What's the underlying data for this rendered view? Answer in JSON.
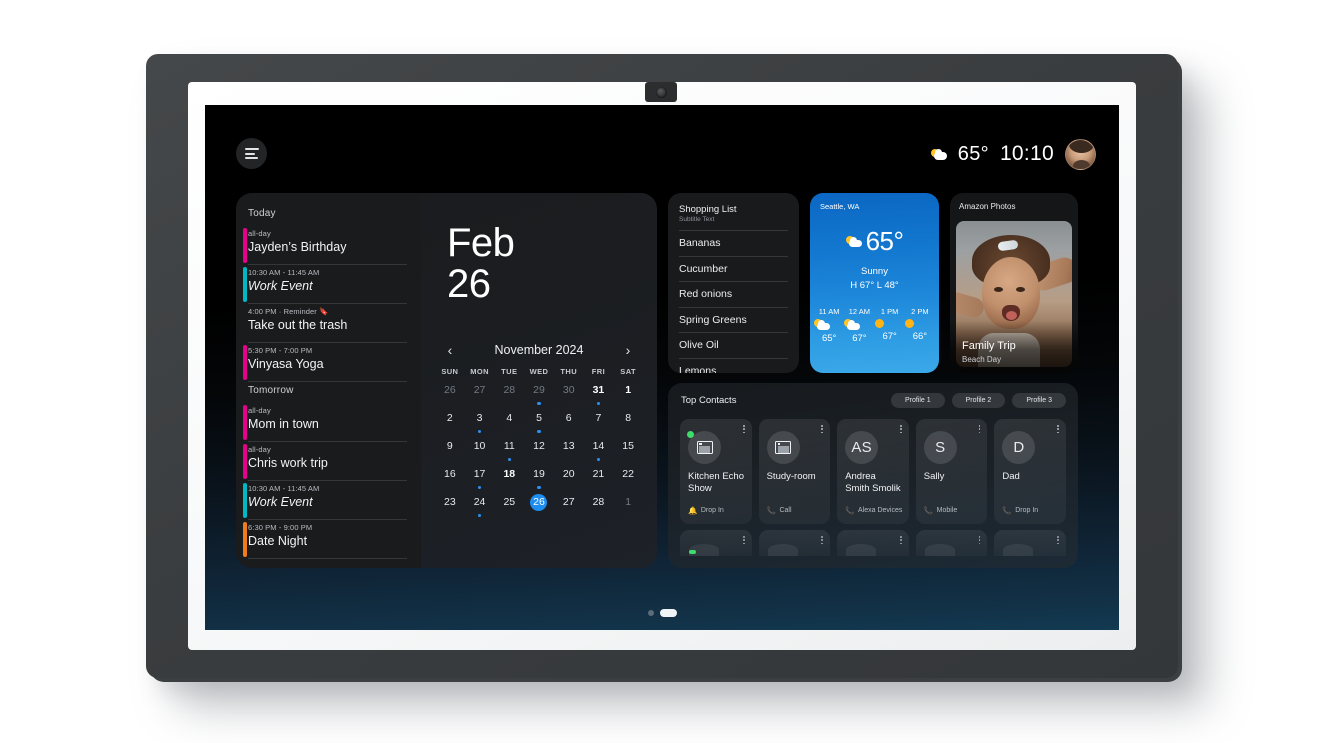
{
  "status_bar": {
    "menu_icon": "hamburger-menu-icon",
    "weather_icon": "partly-cloudy-icon",
    "temperature": "65°",
    "time": "10:10",
    "avatar": "user-avatar"
  },
  "calendar_widget": {
    "big_date": {
      "month": "Feb",
      "day": "26"
    },
    "month_nav": {
      "prev": "‹",
      "label": "November 2024",
      "next": "›"
    },
    "weekdays": [
      "SUN",
      "MON",
      "TUE",
      "WED",
      "THU",
      "FRI",
      "SAT"
    ],
    "weeks": [
      [
        {
          "n": "26",
          "dim": true,
          "bold": false,
          "sel": false,
          "dot": false
        },
        {
          "n": "27",
          "dim": true,
          "bold": false,
          "sel": false,
          "dot": false
        },
        {
          "n": "28",
          "dim": true,
          "bold": false,
          "sel": false,
          "dot": false
        },
        {
          "n": "29",
          "dim": true,
          "bold": false,
          "sel": false,
          "dot": true
        },
        {
          "n": "30",
          "dim": true,
          "bold": false,
          "sel": false,
          "dot": false
        },
        {
          "n": "31",
          "dim": false,
          "bold": true,
          "sel": false,
          "dot": true
        },
        {
          "n": "1",
          "dim": false,
          "bold": true,
          "sel": false,
          "dot": false
        }
      ],
      [
        {
          "n": "2",
          "dim": false,
          "bold": false,
          "sel": false,
          "dot": false
        },
        {
          "n": "3",
          "dim": false,
          "bold": false,
          "sel": false,
          "dot": true
        },
        {
          "n": "4",
          "dim": false,
          "bold": false,
          "sel": false,
          "dot": false
        },
        {
          "n": "5",
          "dim": false,
          "bold": false,
          "sel": false,
          "dot": true
        },
        {
          "n": "6",
          "dim": false,
          "bold": false,
          "sel": false,
          "dot": false
        },
        {
          "n": "7",
          "dim": false,
          "bold": false,
          "sel": false,
          "dot": false
        },
        {
          "n": "8",
          "dim": false,
          "bold": false,
          "sel": false,
          "dot": false
        }
      ],
      [
        {
          "n": "9",
          "dim": false,
          "bold": false,
          "sel": false,
          "dot": false
        },
        {
          "n": "10",
          "dim": false,
          "bold": false,
          "sel": false,
          "dot": false
        },
        {
          "n": "11",
          "dim": false,
          "bold": false,
          "sel": false,
          "dot": true
        },
        {
          "n": "12",
          "dim": false,
          "bold": false,
          "sel": false,
          "dot": false
        },
        {
          "n": "13",
          "dim": false,
          "bold": false,
          "sel": false,
          "dot": false
        },
        {
          "n": "14",
          "dim": false,
          "bold": false,
          "sel": false,
          "dot": true
        },
        {
          "n": "15",
          "dim": false,
          "bold": false,
          "sel": false,
          "dot": false
        }
      ],
      [
        {
          "n": "16",
          "dim": false,
          "bold": false,
          "sel": false,
          "dot": false
        },
        {
          "n": "17",
          "dim": false,
          "bold": false,
          "sel": false,
          "dot": true
        },
        {
          "n": "18",
          "dim": false,
          "bold": true,
          "sel": false,
          "dot": false
        },
        {
          "n": "19",
          "dim": false,
          "bold": false,
          "sel": false,
          "dot": true
        },
        {
          "n": "20",
          "dim": false,
          "bold": false,
          "sel": false,
          "dot": false
        },
        {
          "n": "21",
          "dim": false,
          "bold": false,
          "sel": false,
          "dot": false
        },
        {
          "n": "22",
          "dim": false,
          "bold": false,
          "sel": false,
          "dot": false
        }
      ],
      [
        {
          "n": "23",
          "dim": false,
          "bold": false,
          "sel": false,
          "dot": false
        },
        {
          "n": "24",
          "dim": false,
          "bold": false,
          "sel": false,
          "dot": true
        },
        {
          "n": "25",
          "dim": false,
          "bold": false,
          "sel": false,
          "dot": false
        },
        {
          "n": "26",
          "dim": false,
          "bold": false,
          "sel": true,
          "dot": false
        },
        {
          "n": "27",
          "dim": false,
          "bold": false,
          "sel": false,
          "dot": false
        },
        {
          "n": "28",
          "dim": false,
          "bold": false,
          "sel": false,
          "dot": false
        },
        {
          "n": "1",
          "dim": true,
          "bold": false,
          "sel": false,
          "dot": false
        }
      ]
    ],
    "sections": [
      {
        "label": "Today",
        "events": [
          {
            "meta": "all-day",
            "title": "Jayden’s Birthday",
            "color": "#E6008C",
            "italic": false
          },
          {
            "meta": "10:30 AM - 11:45 AM",
            "title": "Work Event",
            "color": "#00B8C4",
            "italic": true
          },
          {
            "meta": "4:00 PM · Reminder 🔖",
            "title": "Take out the trash",
            "color": "transparent",
            "italic": false
          },
          {
            "meta": "5:30 PM - 7:00 PM",
            "title": "Vinyasa Yoga",
            "color": "#E6008C",
            "italic": false
          }
        ]
      },
      {
        "label": "Tomorrow",
        "events": [
          {
            "meta": "all-day",
            "title": "Mom in town",
            "color": "#E6008C",
            "italic": false
          },
          {
            "meta": "all-day",
            "title": "Chris work trip",
            "color": "#E6008C",
            "italic": false
          },
          {
            "meta": "10:30 AM - 11:45 AM",
            "title": "Work Event",
            "color": "#00B8C4",
            "italic": true
          },
          {
            "meta": "6:30 PM - 9:00 PM",
            "title": "Date Night",
            "color": "#F07C1E",
            "italic": false
          }
        ]
      }
    ]
  },
  "shopping_list": {
    "title": "Shopping List",
    "subtitle": "Subtitle Text",
    "items": [
      "Bananas",
      "Cucumber",
      "Red onions",
      "Spring Greens",
      "Olive Oil",
      "Lemons"
    ]
  },
  "weather": {
    "city": "Seattle, WA",
    "icon": "partly-cloudy-icon",
    "temperature": "65°",
    "condition": "Sunny",
    "high_low": "H 67°  L 48°",
    "hourly": [
      {
        "hour": "11 AM",
        "icon": "partly-cloudy-icon",
        "temp": "65°"
      },
      {
        "hour": "12 AM",
        "icon": "partly-cloudy-icon",
        "temp": "67°"
      },
      {
        "hour": "1 PM",
        "icon": "sun-icon",
        "temp": "67°"
      },
      {
        "hour": "2 PM",
        "icon": "sun-icon",
        "temp": "66°"
      }
    ],
    "accent": "#1E88DA"
  },
  "photos": {
    "label": "Amazon Photos",
    "caption_title": "Family Trip",
    "caption_subtitle": "Beach Day"
  },
  "contacts": {
    "title": "Top Contacts",
    "profiles": [
      "Profile 1",
      "Profile 2",
      "Profile 3"
    ],
    "cards": [
      {
        "avatar_type": "device",
        "initials": "",
        "name": "Kitchen Echo Show",
        "action_icon": "drop-in-icon",
        "action": "Drop In",
        "online": true
      },
      {
        "avatar_type": "device",
        "initials": "",
        "name": "Study-room",
        "action_icon": "phone-icon",
        "action": "Call",
        "online": false
      },
      {
        "avatar_type": "initials",
        "initials": "AS",
        "name": "Andrea Smith Smolik",
        "action_icon": "phone-icon",
        "action": "Alexa Devices",
        "online": false
      },
      {
        "avatar_type": "initials",
        "initials": "S",
        "name": "Sally",
        "action_icon": "phone-icon",
        "action": "Mobile",
        "online": false
      },
      {
        "avatar_type": "initials",
        "initials": "D",
        "name": "Dad",
        "action_icon": "phone-icon",
        "action": "Drop In",
        "online": false
      }
    ]
  },
  "page_indicator": {
    "pages": 2,
    "active": 2
  }
}
